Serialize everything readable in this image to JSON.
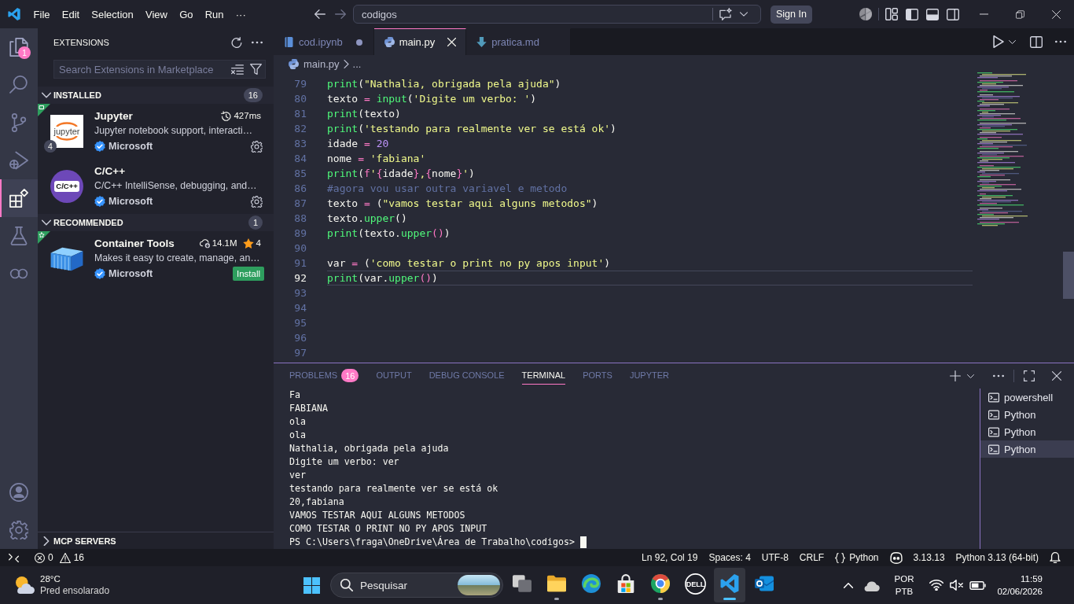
{
  "title_bar": {
    "menus": [
      "File",
      "Edit",
      "Selection",
      "View",
      "Go",
      "Run",
      "···"
    ],
    "command_center": "codigos",
    "sign_in": "Sign In"
  },
  "activity_bar": {
    "items": [
      {
        "kind": "explorer",
        "selected": false,
        "badge": "1"
      },
      {
        "kind": "search",
        "selected": false
      },
      {
        "kind": "source-control",
        "selected": false
      },
      {
        "kind": "run-debug",
        "selected": false
      },
      {
        "kind": "extensions",
        "selected": true
      },
      {
        "kind": "testing",
        "selected": false
      },
      {
        "kind": "rings",
        "selected": false
      }
    ],
    "bottom": [
      {
        "kind": "account"
      },
      {
        "kind": "settings"
      }
    ]
  },
  "sidebar": {
    "title": "EXTENSIONS",
    "search": {
      "placeholder": "Search Extensions in Marketplace"
    },
    "sections": [
      {
        "title": "INSTALLED",
        "expanded": true,
        "count": "16",
        "items": [
          {
            "name": "Jupyter",
            "logo": {
              "kind": "jupyter",
              "text": "jupyter"
            },
            "corner": {
              "kind": "square"
            },
            "badge": "4",
            "stat": {
              "kind": "activation",
              "text": "427ms"
            },
            "description": "Jupyter notebook support, interacti…",
            "publisher": "Microsoft",
            "action": {
              "kind": "manage"
            }
          },
          {
            "name": "C/C++",
            "logo": {
              "kind": "cpp",
              "text": "C/C++"
            },
            "description": "C/C++ IntelliSense, debugging, and…",
            "publisher": "Microsoft",
            "action": {
              "kind": "manage"
            }
          }
        ]
      },
      {
        "title": "RECOMMENDED",
        "expanded": true,
        "count": "1",
        "items": [
          {
            "name": "Container Tools",
            "logo": {
              "kind": "container"
            },
            "corner": {
              "kind": "star"
            },
            "stat": {
              "kind": "downloads",
              "text": "14.1M"
            },
            "rating": "4",
            "description": "Makes it easy to create, manage, an…",
            "publisher": "Microsoft",
            "action": {
              "kind": "install",
              "label": "Install"
            }
          }
        ]
      },
      {
        "title": "MCP SERVERS",
        "expanded": false
      }
    ]
  },
  "editor": {
    "tabs": [
      {
        "label": "cod.ipynb",
        "kind": "notebook",
        "modified": true,
        "selected": false
      },
      {
        "label": "main.py",
        "kind": "python",
        "modified": false,
        "selected": true
      },
      {
        "label": "pratica.md",
        "kind": "markdown",
        "modified": false,
        "selected": false
      }
    ],
    "breadcrumbs": [
      {
        "label": "main.py",
        "kind": "python"
      },
      {
        "label": "..."
      }
    ],
    "lines": [
      {
        "number": "79",
        "current": false,
        "tokens": [
          {
            "text": "print",
            "kind": "function"
          },
          {
            "text": "(",
            "kind": "plain"
          },
          {
            "text": "\"Nathalia, obrigada pela ajuda\"",
            "kind": "string"
          },
          {
            "text": ")",
            "kind": "plain"
          }
        ]
      },
      {
        "number": "80",
        "current": false,
        "tokens": [
          {
            "text": "texto",
            "kind": "plain"
          },
          {
            "text": " = ",
            "kind": "operator"
          },
          {
            "text": "input",
            "kind": "function"
          },
          {
            "text": "(",
            "kind": "plain"
          },
          {
            "text": "'Digite um verbo: '",
            "kind": "string"
          },
          {
            "text": ")",
            "kind": "plain"
          }
        ]
      },
      {
        "number": "81",
        "current": false,
        "tokens": [
          {
            "text": "print",
            "kind": "function"
          },
          {
            "text": "(texto)",
            "kind": "plain"
          }
        ]
      },
      {
        "number": "82",
        "current": false,
        "tokens": [
          {
            "text": "print",
            "kind": "function"
          },
          {
            "text": "(",
            "kind": "plain"
          },
          {
            "text": "'testando para realmente ver se está ok'",
            "kind": "string"
          },
          {
            "text": ")",
            "kind": "plain"
          }
        ]
      },
      {
        "number": "83",
        "current": false,
        "tokens": [
          {
            "text": "idade",
            "kind": "plain"
          },
          {
            "text": " = ",
            "kind": "operator"
          },
          {
            "text": "20",
            "kind": "number"
          }
        ]
      },
      {
        "number": "84",
        "current": false,
        "tokens": [
          {
            "text": "nome",
            "kind": "plain"
          },
          {
            "text": " = ",
            "kind": "operator"
          },
          {
            "text": "'fabiana'",
            "kind": "string"
          }
        ]
      },
      {
        "number": "85",
        "current": false,
        "tokens": [
          {
            "text": "print",
            "kind": "function"
          },
          {
            "text": "(",
            "kind": "plain"
          },
          {
            "text": "f",
            "kind": "operator"
          },
          {
            "text": "'",
            "kind": "string"
          },
          {
            "text": "{",
            "kind": "operator"
          },
          {
            "text": "idade",
            "kind": "plain"
          },
          {
            "text": "}",
            "kind": "operator"
          },
          {
            "text": ",",
            "kind": "string"
          },
          {
            "text": "{",
            "kind": "operator"
          },
          {
            "text": "nome",
            "kind": "plain"
          },
          {
            "text": "}",
            "kind": "operator"
          },
          {
            "text": "'",
            "kind": "string"
          },
          {
            "text": ")",
            "kind": "plain"
          }
        ]
      },
      {
        "number": "86",
        "current": false,
        "tokens": [
          {
            "text": "#agora vou usar outra variavel e metodo",
            "kind": "comment"
          }
        ]
      },
      {
        "number": "87",
        "current": false,
        "tokens": [
          {
            "text": "texto",
            "kind": "plain"
          },
          {
            "text": " = ",
            "kind": "operator"
          },
          {
            "text": "(",
            "kind": "plain"
          },
          {
            "text": "\"vamos testar aqui alguns metodos\"",
            "kind": "string"
          },
          {
            "text": ")",
            "kind": "plain"
          }
        ]
      },
      {
        "number": "88",
        "current": false,
        "tokens": [
          {
            "text": "texto.",
            "kind": "plain"
          },
          {
            "text": "upper",
            "kind": "function"
          },
          {
            "text": "()",
            "kind": "plain"
          }
        ]
      },
      {
        "number": "89",
        "current": false,
        "tokens": [
          {
            "text": "print",
            "kind": "function"
          },
          {
            "text": "(texto.",
            "kind": "plain"
          },
          {
            "text": "upper",
            "kind": "function"
          },
          {
            "text": "()",
            "kind": "operator"
          },
          {
            "text": ")",
            "kind": "plain"
          }
        ]
      },
      {
        "number": "90",
        "current": false
      },
      {
        "number": "91",
        "current": false,
        "tokens": [
          {
            "text": "var",
            "kind": "plain"
          },
          {
            "text": " = ",
            "kind": "operator"
          },
          {
            "text": "(",
            "kind": "plain"
          },
          {
            "text": "'como testar o print no py apos input'",
            "kind": "string"
          },
          {
            "text": ")",
            "kind": "plain"
          }
        ]
      },
      {
        "number": "92",
        "current": true,
        "tokens": [
          {
            "text": "print",
            "kind": "function"
          },
          {
            "text": "(var.",
            "kind": "plain"
          },
          {
            "text": "upper",
            "kind": "function"
          },
          {
            "text": "()",
            "kind": "operator"
          },
          {
            "text": ")",
            "kind": "plain"
          }
        ]
      },
      {
        "number": "93",
        "current": false
      },
      {
        "number": "94",
        "current": false
      },
      {
        "number": "95",
        "current": false
      },
      {
        "number": "96",
        "current": false
      },
      {
        "number": "97",
        "current": false
      }
    ]
  },
  "panel": {
    "tabs": [
      {
        "label": "PROBLEMS",
        "badge": "16",
        "selected": false
      },
      {
        "label": "OUTPUT",
        "selected": false
      },
      {
        "label": "DEBUG CONSOLE",
        "selected": false
      },
      {
        "label": "TERMINAL",
        "selected": true
      },
      {
        "label": "PORTS",
        "selected": false
      },
      {
        "label": "JUPYTER",
        "selected": false
      }
    ],
    "terminal_lines": [
      "Fa",
      "FABIANA",
      "ola",
      "ola",
      "Nathalia, obrigada pela ajuda",
      "Digite um verbo: ver",
      "ver",
      "testando para realmente ver se está ok",
      "20,fabiana",
      "VAMOS TESTAR AQUI ALGUNS METODOS",
      "COMO TESTAR O PRINT NO PY APOS INPUT"
    ],
    "prompt": "PS C:\\Users\\fraga\\OneDrive\\Área de Trabalho\\codigos>",
    "terminals": [
      {
        "label": "powershell",
        "selected": false
      },
      {
        "label": "Python",
        "selected": false
      },
      {
        "label": "Python",
        "selected": false
      },
      {
        "label": "Python",
        "selected": true
      }
    ]
  },
  "status_bar": {
    "errors": "0",
    "warnings": "16",
    "items": [
      {
        "kind": "text",
        "text": "Ln 92, Col 19"
      },
      {
        "kind": "text",
        "text": "Spaces: 4"
      },
      {
        "kind": "text",
        "text": "UTF-8"
      },
      {
        "kind": "text",
        "text": "CRLF"
      },
      {
        "kind": "language",
        "text": "Python"
      },
      {
        "kind": "copilot"
      },
      {
        "kind": "text",
        "text": "3.13.13"
      },
      {
        "kind": "text",
        "text": "Python 3.13 (64-bit)"
      },
      {
        "kind": "bell"
      }
    ]
  },
  "taskbar": {
    "weather": {
      "temperature": "28°C",
      "condition": "Pred ensolarado"
    },
    "search": {
      "placeholder": "Pesquisar"
    },
    "apps": [
      {
        "kind": "task-view",
        "running": false,
        "selected": false
      },
      {
        "kind": "file-explorer",
        "running": true,
        "selected": false
      },
      {
        "kind": "edge",
        "running": false,
        "selected": false
      },
      {
        "kind": "store",
        "running": false,
        "selected": false
      },
      {
        "kind": "chrome",
        "running": true,
        "selected": false
      },
      {
        "kind": "dell",
        "label": "DELL",
        "running": false,
        "selected": false
      },
      {
        "kind": "vscode",
        "running": true,
        "selected": true
      },
      {
        "kind": "outlook",
        "running": false,
        "selected": false
      }
    ],
    "language": [
      "POR",
      "PTB"
    ],
    "time": "11:59",
    "date": "02/06/2026"
  }
}
